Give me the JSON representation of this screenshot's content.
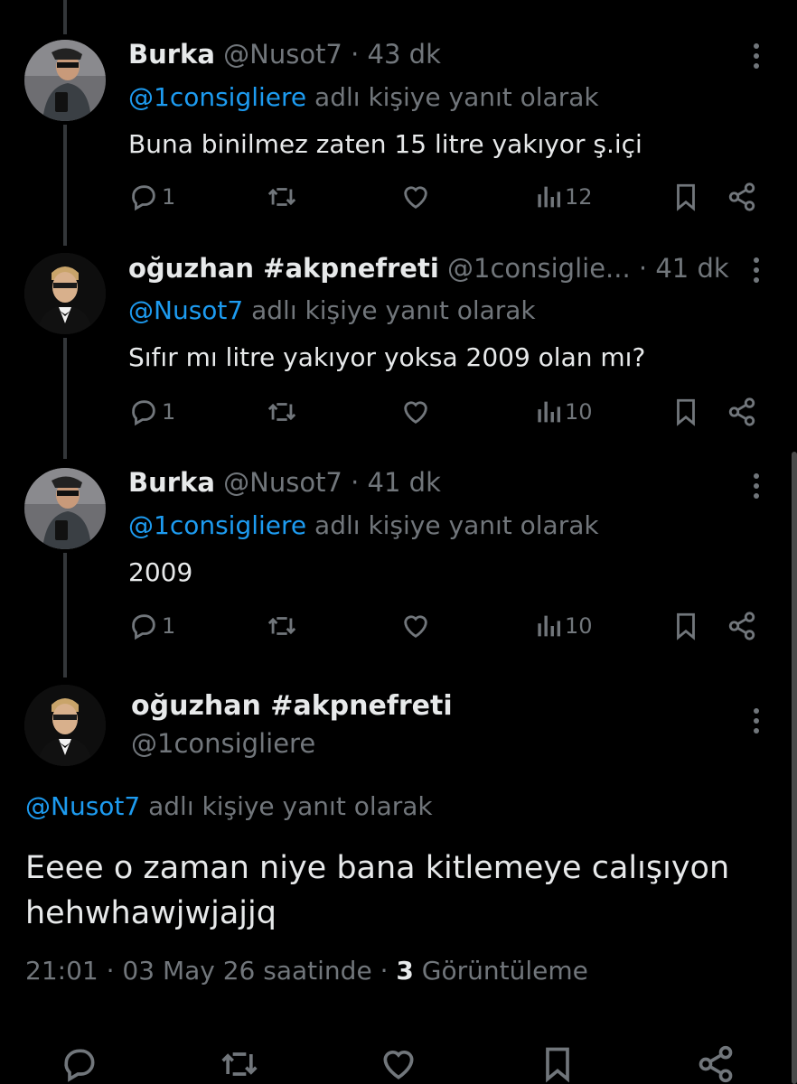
{
  "replying_suffix": "adlı kişiye yanıt olarak",
  "thread": [
    {
      "name": "Burka",
      "handle": "@Nusot7",
      "separator": "·",
      "time": "43 dk",
      "reply_to": "@1consigliere",
      "text": "Buna binilmez zaten 15 litre yakıyor ş.içi",
      "replies": "1",
      "views": "12",
      "avatar": "man-with-sunglasses-avatar"
    },
    {
      "name": "oğuzhan #akpnefreti",
      "handle": "@1consiglie...",
      "separator": "·",
      "time": "41 dk",
      "reply_to": "@Nusot7",
      "text": "Sıfır mı litre yakıyor yoksa 2009 olan mı?",
      "replies": "1",
      "views": "10",
      "avatar": "man-in-tuxedo-avatar"
    },
    {
      "name": "Burka",
      "handle": "@Nusot7",
      "separator": "·",
      "time": "41 dk",
      "reply_to": "@1consigliere",
      "text": "2009",
      "replies": "1",
      "views": "10",
      "avatar": "man-with-sunglasses-avatar"
    }
  ],
  "main_tweet": {
    "name": "oğuzhan #akpnefreti",
    "handle": "@1consigliere",
    "reply_to": "@Nusot7",
    "text_line1": "Eeee o zaman niye bana kitlemeye calışıyon",
    "text_line2": "hehwhawjwjajjq",
    "time": "21:01",
    "date": "03 May 26 saatinde",
    "separator": "·",
    "views_count": "3",
    "views_label": "Görüntüleme"
  },
  "icons": [
    "reply-icon",
    "retweet-icon",
    "like-icon",
    "views-icon",
    "bookmark-icon",
    "share-icon",
    "more-icon"
  ],
  "colors": {
    "background": "#000000",
    "text": "#e7e9ea",
    "muted": "#71767b",
    "link": "#1d9bf0",
    "thread_line": "#333639"
  }
}
